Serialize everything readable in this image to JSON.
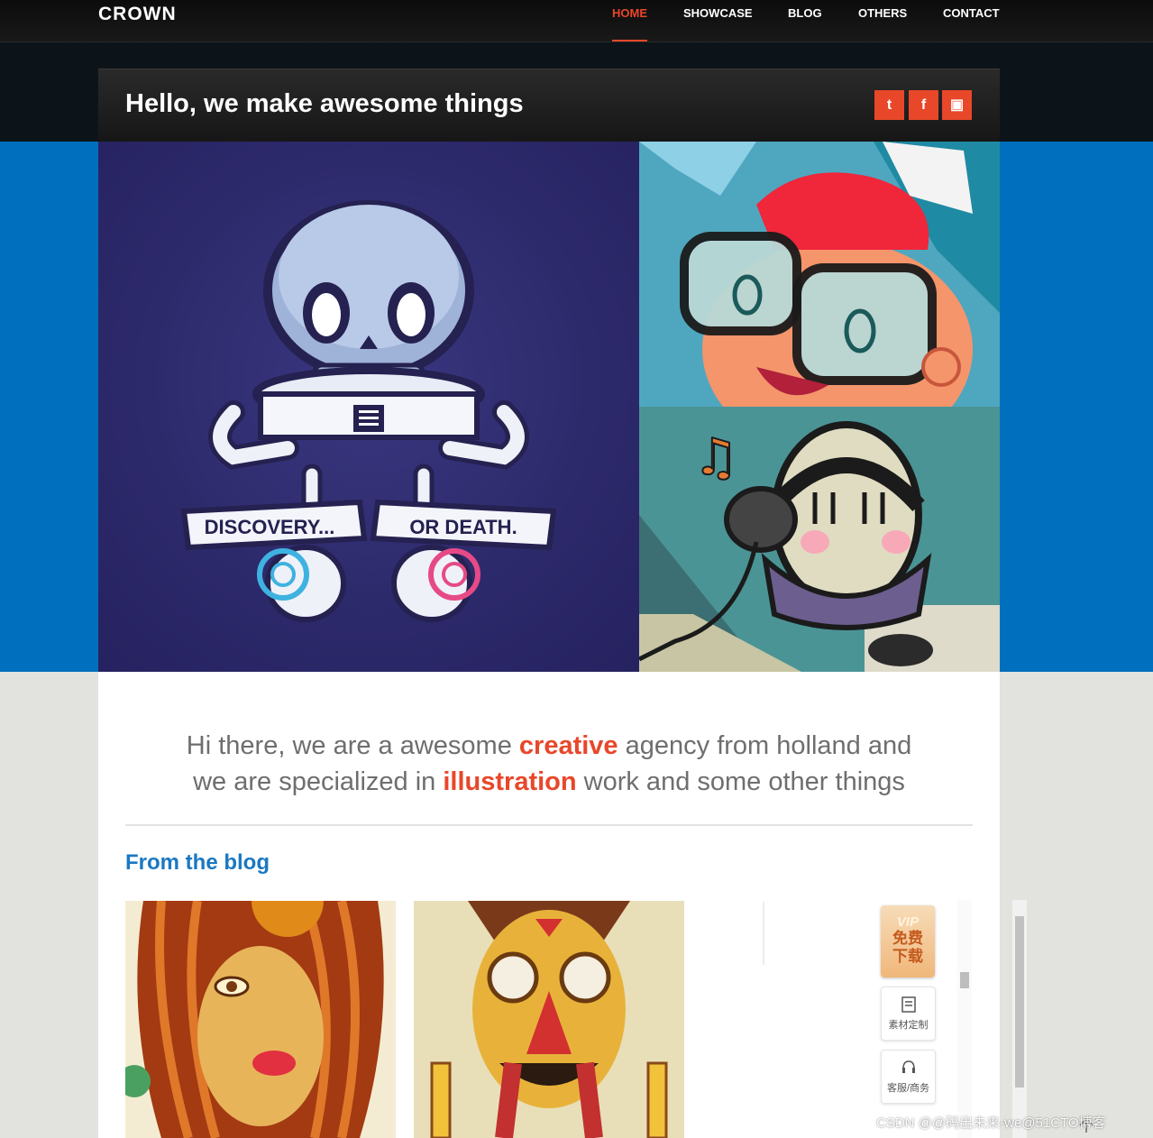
{
  "brand": {
    "logo": "CROWN"
  },
  "nav": {
    "items": [
      {
        "label": "HOME",
        "active": true
      },
      {
        "label": "SHOWCASE",
        "active": false
      },
      {
        "label": "BLOG",
        "active": false
      },
      {
        "label": "OTHERS",
        "active": false
      },
      {
        "label": "CONTACT",
        "active": false
      }
    ]
  },
  "header": {
    "headline": "Hello, we make awesome things",
    "social": [
      {
        "icon": "twitter-icon",
        "glyph": "t"
      },
      {
        "icon": "facebook-icon",
        "glyph": "f"
      },
      {
        "icon": "calendar-icon",
        "glyph": "▣"
      }
    ]
  },
  "hero": {
    "banner_left": "DISCOVERY...",
    "banner_right": "OR DEATH."
  },
  "intro": {
    "line1_a": "Hi there, we are a awesome ",
    "line1_hl": "creative",
    "line1_b": " agency from holland and",
    "line2_a": "we are specialized in ",
    "line2_hl": "illustration",
    "line2_b": " work and some other things"
  },
  "blog": {
    "title": "From the blog"
  },
  "widget": {
    "vip_top": "VIP",
    "vip_bottom": "免费\n下载",
    "btn1_label": "素材定制",
    "btn2_label": "客服/商务"
  },
  "watermark": "CSDN @@码出未来-we@51CTO博客",
  "colors": {
    "accent": "#e8472a",
    "blue_band": "#0070be",
    "blog_title": "#1a78c2"
  }
}
